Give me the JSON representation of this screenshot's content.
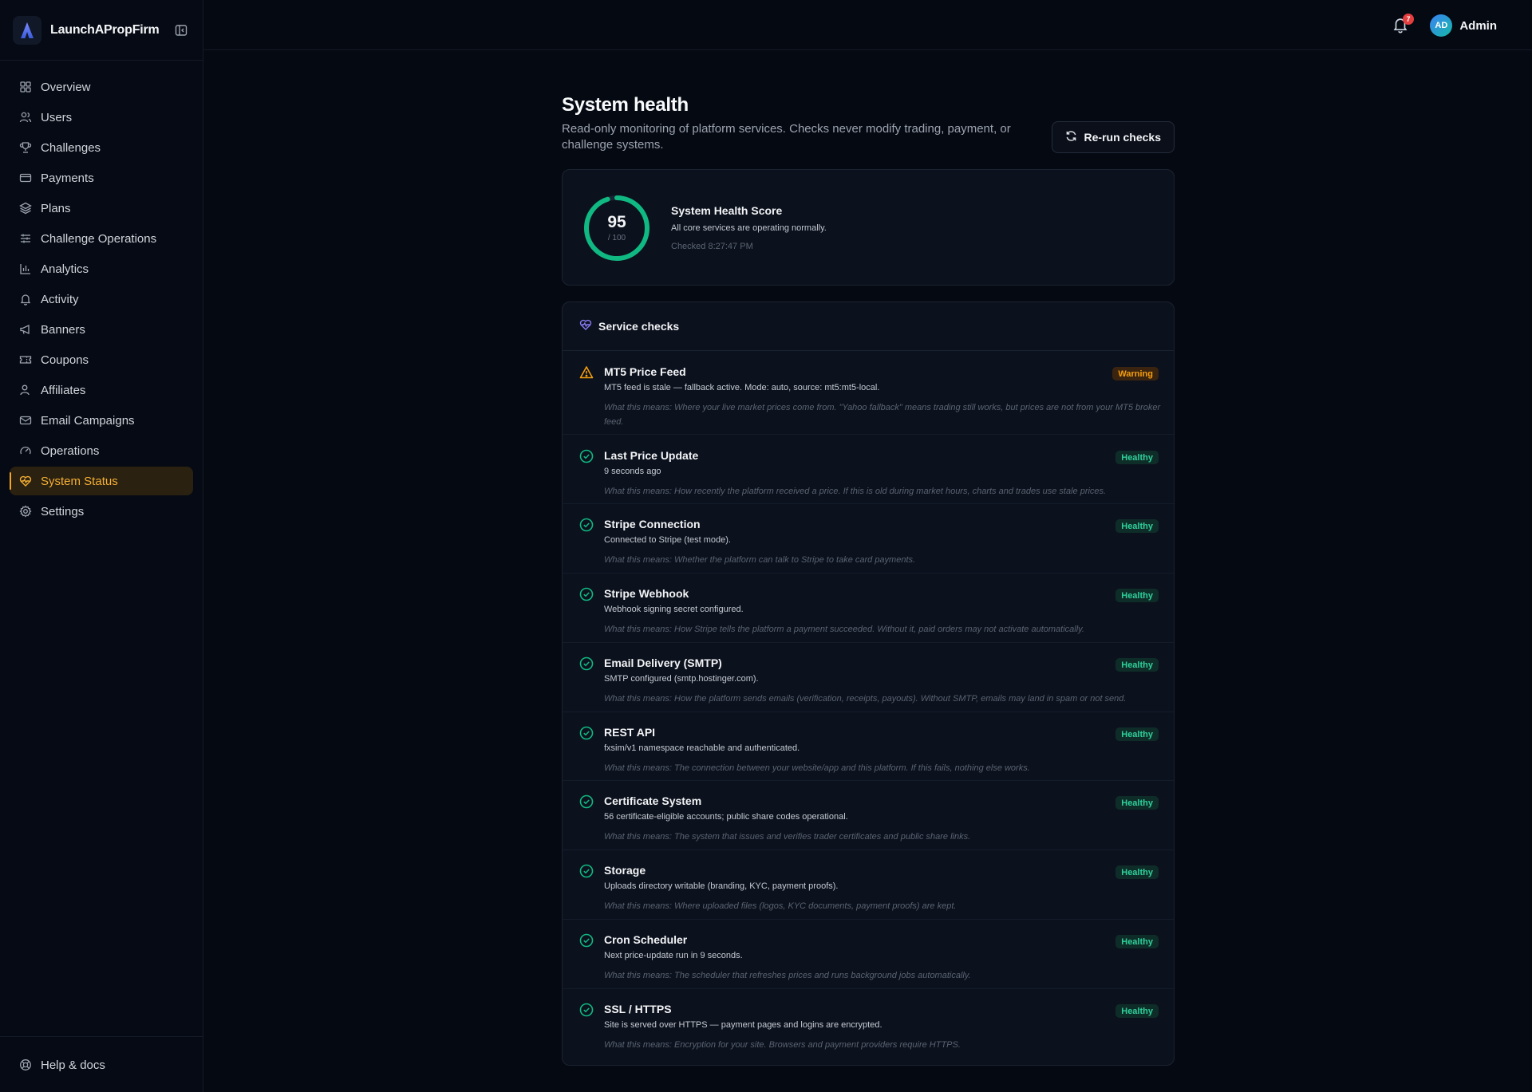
{
  "app": {
    "name": "LaunchAPropFirm"
  },
  "sidebar": {
    "items": [
      {
        "label": "Overview",
        "icon": "grid-icon"
      },
      {
        "label": "Users",
        "icon": "users-icon"
      },
      {
        "label": "Challenges",
        "icon": "trophy-icon"
      },
      {
        "label": "Payments",
        "icon": "credit-card-icon"
      },
      {
        "label": "Plans",
        "icon": "layers-icon"
      },
      {
        "label": "Challenge Operations",
        "icon": "sliders-icon"
      },
      {
        "label": "Analytics",
        "icon": "bar-chart-icon"
      },
      {
        "label": "Activity",
        "icon": "bell-icon"
      },
      {
        "label": "Banners",
        "icon": "megaphone-icon"
      },
      {
        "label": "Coupons",
        "icon": "ticket-icon"
      },
      {
        "label": "Affiliates",
        "icon": "user-icon"
      },
      {
        "label": "Email Campaigns",
        "icon": "mail-icon"
      },
      {
        "label": "Operations",
        "icon": "gauge-icon"
      },
      {
        "label": "System Status",
        "icon": "heart-pulse-icon",
        "active": true
      },
      {
        "label": "Settings",
        "icon": "gear-icon"
      }
    ],
    "footer": {
      "label": "Help & docs",
      "icon": "lifebuoy-icon"
    }
  },
  "topbar": {
    "notification_count": "7",
    "user": {
      "initials": "AD",
      "name": "Admin"
    }
  },
  "page": {
    "title": "System health",
    "subtitle": "Read-only monitoring of platform services. Checks never modify trading, payment, or challenge systems.",
    "rerun_label": "Re-run checks"
  },
  "score": {
    "value": "95",
    "max": "/ 100",
    "fraction": 0.95,
    "title": "System Health Score",
    "description": "All core services are operating normally.",
    "checked": "Checked 8:27:47 PM"
  },
  "checks": {
    "title": "Service checks",
    "items": [
      {
        "name": "MT5 Price Feed",
        "status": "Warning",
        "detail": "MT5 feed is stale — fallback active. Mode: auto, source: mt5:mt5-local.",
        "help": "What this means: Where your live market prices come from. \"Yahoo fallback\" means trading still works, but prices are not from your MT5 broker feed."
      },
      {
        "name": "Last Price Update",
        "status": "Healthy",
        "detail": "9 seconds ago",
        "help": "What this means: How recently the platform received a price. If this is old during market hours, charts and trades use stale prices."
      },
      {
        "name": "Stripe Connection",
        "status": "Healthy",
        "detail": "Connected to Stripe (test mode).",
        "help": "What this means: Whether the platform can talk to Stripe to take card payments."
      },
      {
        "name": "Stripe Webhook",
        "status": "Healthy",
        "detail": "Webhook signing secret configured.",
        "help": "What this means: How Stripe tells the platform a payment succeeded. Without it, paid orders may not activate automatically."
      },
      {
        "name": "Email Delivery (SMTP)",
        "status": "Healthy",
        "detail": "SMTP configured (smtp.hostinger.com).",
        "help": "What this means: How the platform sends emails (verification, receipts, payouts). Without SMTP, emails may land in spam or not send."
      },
      {
        "name": "REST API",
        "status": "Healthy",
        "detail": "fxsim/v1 namespace reachable and authenticated.",
        "help": "What this means: The connection between your website/app and this platform. If this fails, nothing else works."
      },
      {
        "name": "Certificate System",
        "status": "Healthy",
        "detail": "56 certificate-eligible accounts; public share codes operational.",
        "help": "What this means: The system that issues and verifies trader certificates and public share links."
      },
      {
        "name": "Storage",
        "status": "Healthy",
        "detail": "Uploads directory writable (branding, KYC, payment proofs).",
        "help": "What this means: Where uploaded files (logos, KYC documents, payment proofs) are kept."
      },
      {
        "name": "Cron Scheduler",
        "status": "Healthy",
        "detail": "Next price-update run in 9 seconds.",
        "help": "What this means: The scheduler that refreshes prices and runs background jobs automatically."
      },
      {
        "name": "SSL / HTTPS",
        "status": "Healthy",
        "detail": "Site is served over HTTPS — payment pages and logins are encrypted.",
        "help": "What this means: Encryption for your site. Browsers and payment providers require HTTPS."
      }
    ]
  },
  "colors": {
    "accent": "#f5a524",
    "healthy": "#2fd09a",
    "warning": "#f59e0b",
    "gauge": "#10b981"
  }
}
